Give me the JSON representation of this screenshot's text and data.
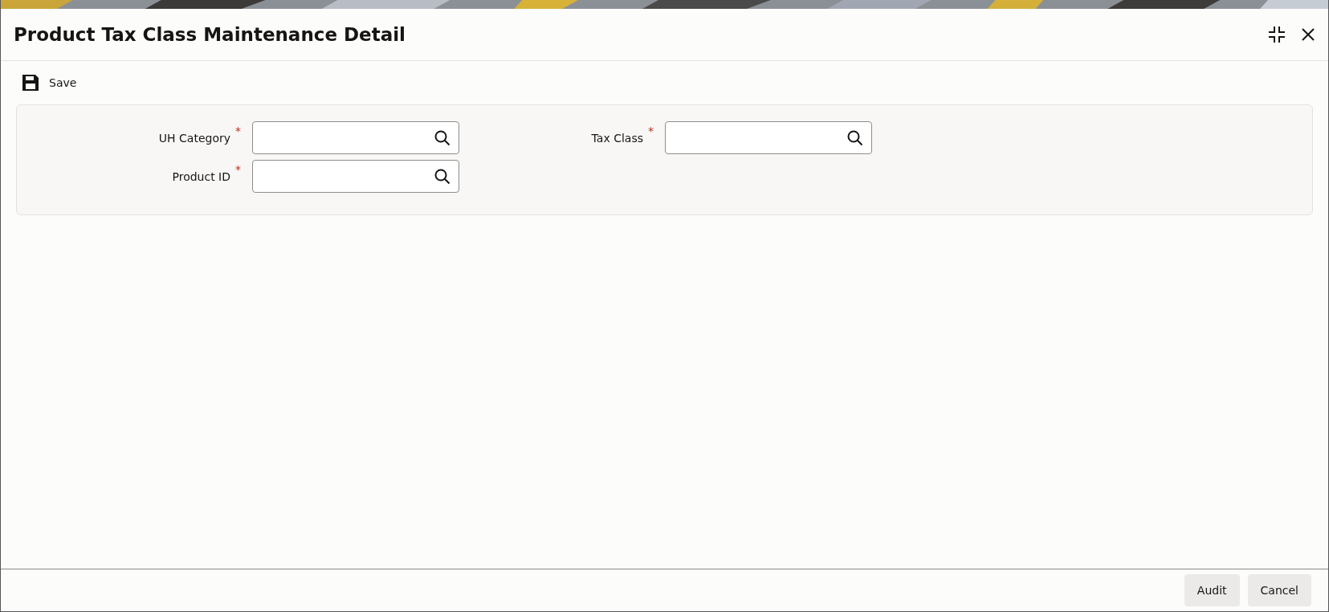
{
  "window": {
    "title": "Product Tax Class Maintenance Detail"
  },
  "toolbar": [
    {
      "label": "Save"
    }
  ],
  "form_columns": [
    {
      "fields": [
        {
          "label": "UH Category",
          "required_mark": "*"
        },
        {
          "label": "Product ID",
          "required_mark": "*"
        }
      ]
    },
    {
      "fields": [
        {
          "label": "Tax Class",
          "required_mark": "*"
        }
      ]
    }
  ],
  "footer_buttons": [
    {
      "label": "Audit"
    },
    {
      "label": "Cancel"
    }
  ]
}
